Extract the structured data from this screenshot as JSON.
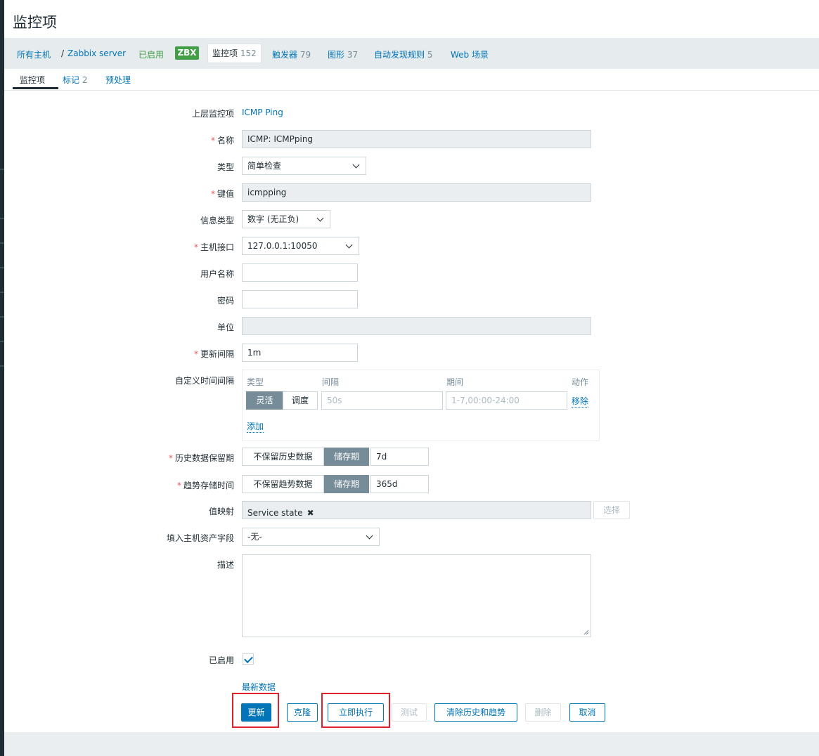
{
  "page_title": "监控项",
  "breadcrumbs": {
    "all_hosts": "所有主机",
    "separator": "/",
    "host": "Zabbix server",
    "enabled": "已启用",
    "zbx": "ZBX",
    "items_label": "监控项",
    "items_count": "152",
    "triggers_label": "触发器",
    "triggers_count": "79",
    "graphs_label": "图形",
    "graphs_count": "37",
    "discovery_label": "自动发现规则",
    "discovery_count": "5",
    "web_label": "Web 场景"
  },
  "tabs": {
    "item": "监控项",
    "tags_label": "标记",
    "tags_count": "2",
    "preprocessing": "预处理"
  },
  "form": {
    "parent_label": "上层监控项",
    "parent_value": "ICMP Ping",
    "name_label": "名称",
    "name_value": "ICMP: ICMPping",
    "type_label": "类型",
    "type_value": "简单检查",
    "key_label": "键值",
    "key_value": "icmpping",
    "info_type_label": "信息类型",
    "info_type_value": "数字 (无正负)",
    "interface_label": "主机接口",
    "interface_value": "127.0.0.1:10050",
    "username_label": "用户名称",
    "username_value": "",
    "password_label": "密码",
    "password_value": "",
    "units_label": "单位",
    "units_value": "",
    "interval_label": "更新间隔",
    "interval_value": "1m",
    "custom_intervals_label": "自定义时间间隔",
    "custom_intervals": {
      "col_type": "类型",
      "col_interval": "间隔",
      "col_period": "期间",
      "col_action": "动作",
      "flexible": "灵活",
      "scheduling": "调度",
      "interval_value": "50s",
      "period_value": "1-7,00:00-24:00",
      "remove": "移除",
      "add": "添加"
    },
    "history_label": "历史数据保留期",
    "history_no_keep": "不保留历史数据",
    "history_storage": "储存期",
    "history_value": "7d",
    "trends_label": "趋势存储时间",
    "trends_no_keep": "不保留趋势数据",
    "trends_storage": "储存期",
    "trends_value": "365d",
    "valuemap_label": "值映射",
    "valuemap_value": "Service state",
    "valuemap_remove": "✖",
    "valuemap_select": "选择",
    "inventory_label": "填入主机资产字段",
    "inventory_value": "-无-",
    "description_label": "描述",
    "description_value": "",
    "enabled_label": "已启用",
    "latest_data": "最新数据"
  },
  "buttons": {
    "update": "更新",
    "clone": "克隆",
    "execute_now": "立即执行",
    "test": "测试",
    "clear_history": "清除历史和趋势",
    "delete": "删除",
    "cancel": "取消"
  },
  "colors": {
    "primary": "#0275b8",
    "enabled_green": "#429e47",
    "required_red": "#e45959",
    "highlight_red": "#e0212b"
  }
}
